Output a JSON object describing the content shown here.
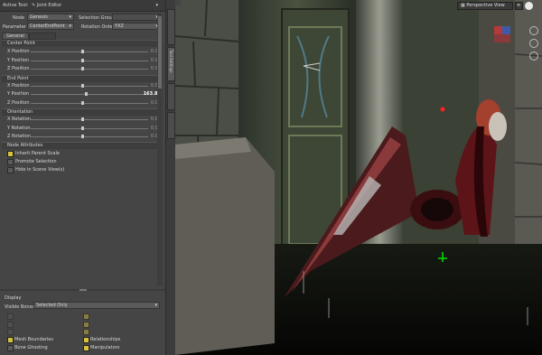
{
  "title_bar": {
    "label": "Active Tool:",
    "tool": "Joint Editor"
  },
  "node": {
    "label": "Node",
    "value": "Genesis",
    "group_label": "Selection Group",
    "group_value": ""
  },
  "parameter": {
    "label": "Parameter",
    "value": "CenterEndPoint",
    "order_label": "Rotation Order",
    "order_value": "YXZ"
  },
  "tabs": {
    "general": "General",
    "other": ""
  },
  "center_point": {
    "header": "Center Point",
    "rows": [
      {
        "label": "X Position",
        "value": "0.00"
      },
      {
        "label": "Y Position",
        "value": "0.00"
      },
      {
        "label": "Z Position",
        "value": "0.00"
      }
    ]
  },
  "end_point": {
    "header": "End Point",
    "rows": [
      {
        "label": "X Position",
        "value": "0.00"
      },
      {
        "label": "Y Position",
        "value": "163.88"
      },
      {
        "label": "Z Position",
        "value": "0.00"
      }
    ]
  },
  "orientation": {
    "header": "Orientation",
    "rows": [
      {
        "label": "X Rotation",
        "value": "0.00"
      },
      {
        "label": "Y Rotation",
        "value": "0.00"
      },
      {
        "label": "Z Rotation",
        "value": "0.00"
      }
    ]
  },
  "node_attributes": {
    "header": "Node Attributes",
    "items": [
      {
        "label": "Inherit Parent Scale",
        "checked": true
      },
      {
        "label": "Promote Selection",
        "checked": false
      },
      {
        "label": "Hide in Scene View(s)",
        "checked": false
      }
    ]
  },
  "display": {
    "header": "Display",
    "visible_label": "Visible Bones",
    "visible_value": "Selected Only",
    "options": [
      {
        "label": "",
        "checked": false,
        "dim": true
      },
      {
        "label": "",
        "checked": true,
        "dim": true
      },
      {
        "label": "",
        "checked": false,
        "dim": true
      },
      {
        "label": "",
        "checked": true,
        "dim": true
      },
      {
        "label": "",
        "checked": false,
        "dim": true
      },
      {
        "label": "",
        "checked": true,
        "dim": true
      },
      {
        "label": "Mesh Boundaries",
        "checked": true,
        "dim": false
      },
      {
        "label": "Relationships",
        "checked": true,
        "dim": false
      },
      {
        "label": "Bone Ghosting",
        "checked": false,
        "dim": false
      },
      {
        "label": "Manipulators",
        "checked": true,
        "dim": false
      }
    ]
  },
  "side_tabs": [
    {
      "label": ""
    },
    {
      "label": "Tool Settings"
    },
    {
      "label": ""
    },
    {
      "label": ""
    }
  ],
  "viewport": {
    "view_label": "Perspective View"
  }
}
